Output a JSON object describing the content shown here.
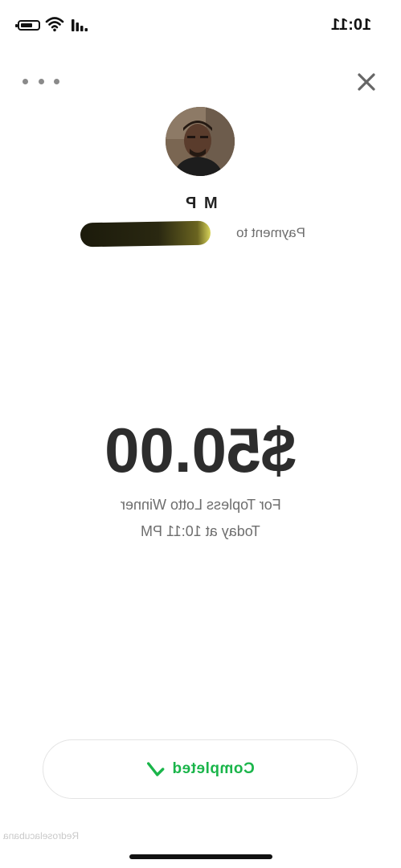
{
  "status_bar": {
    "time": "10:11",
    "icons": [
      "battery-icon",
      "wifi-icon",
      "signal-icon"
    ]
  },
  "header": {
    "more_icon": "more-dots-icon",
    "close_icon": "close-icon"
  },
  "recipient": {
    "name": "M P",
    "payment_prefix": "Payment to"
  },
  "transaction": {
    "amount": "$50.00",
    "note": "For Topless Lotto Winner",
    "timestamp": "Today at 10:11 PM"
  },
  "status": {
    "label": "Completed",
    "icon": "checkmark-icon",
    "color": "#1ab54a"
  },
  "watermark": "Redroselacubana"
}
